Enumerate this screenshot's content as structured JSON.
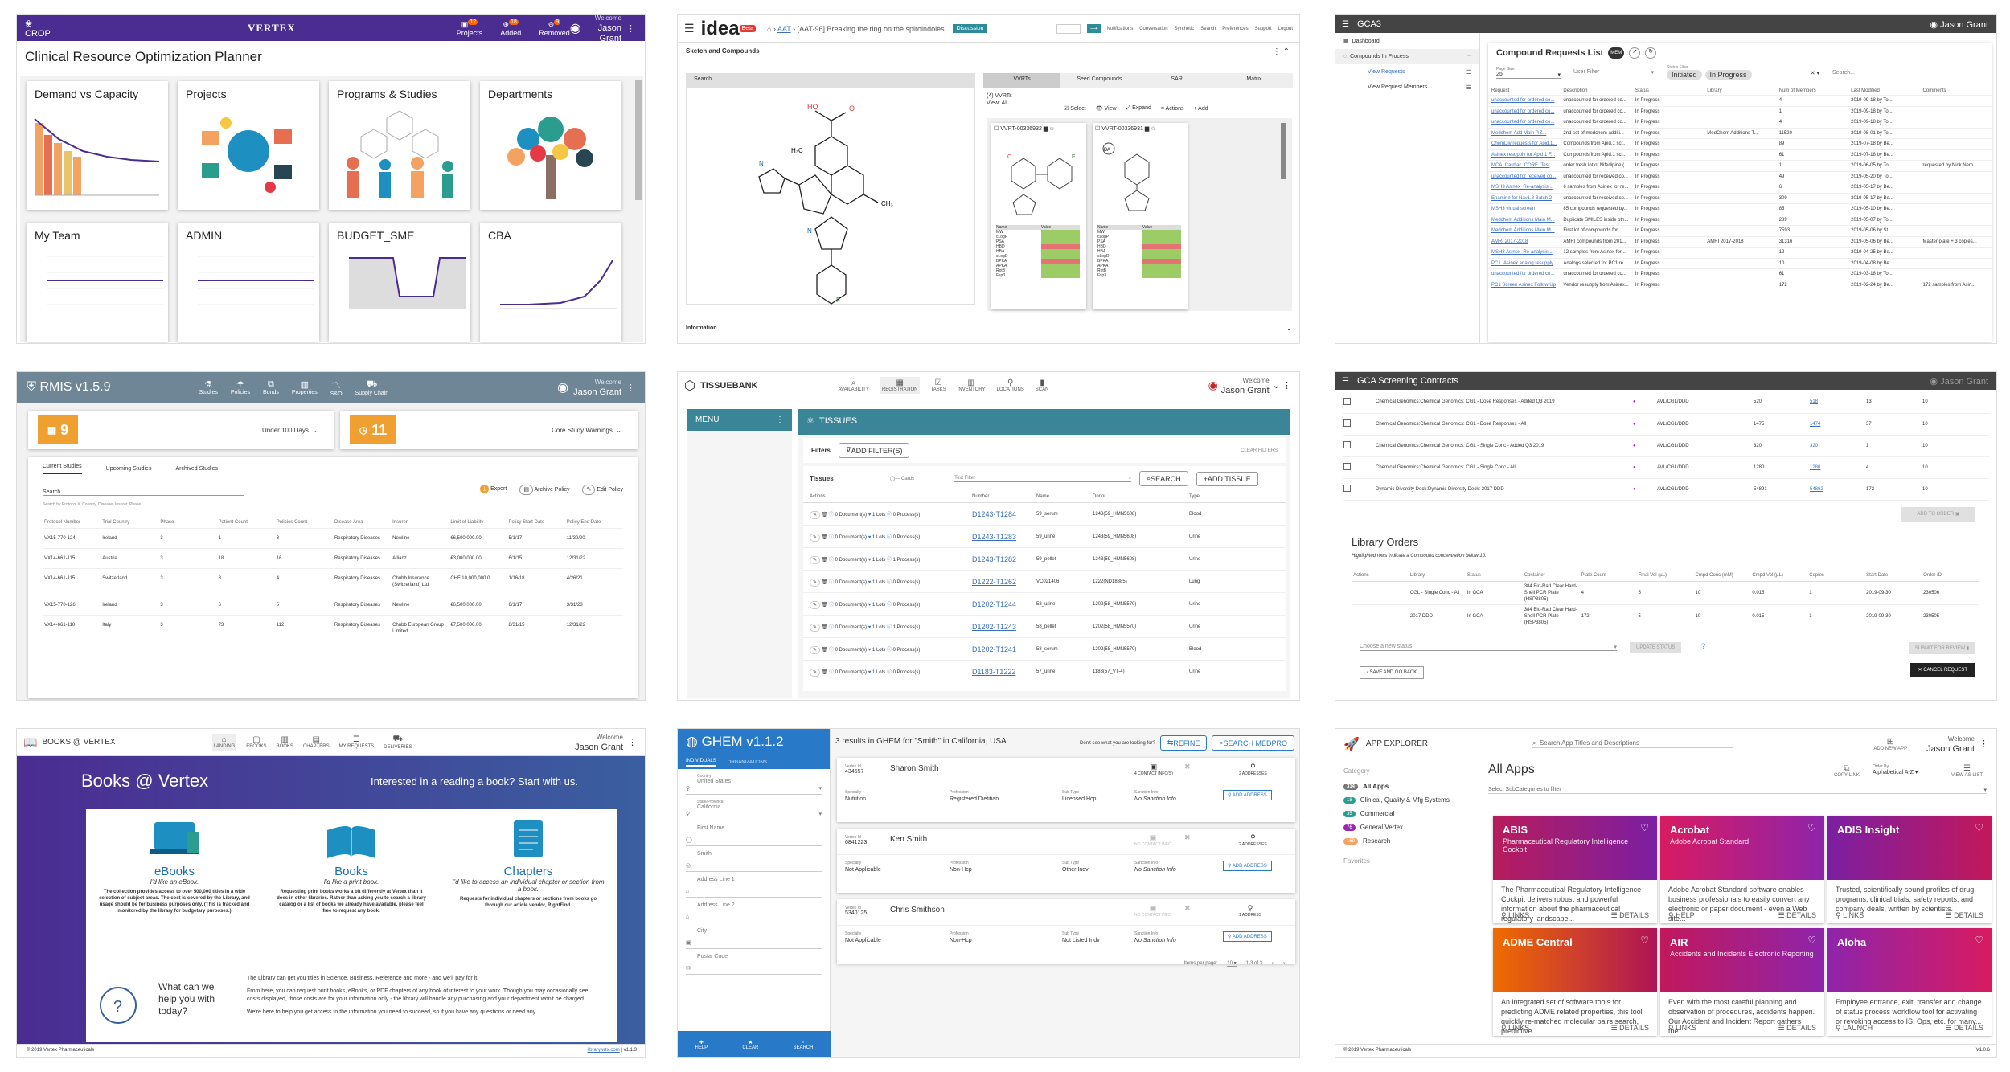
{
  "crop": {
    "brand": "CROP",
    "logo": "VERTEX",
    "welcome": "Welcome",
    "user": "Jason Grant",
    "nav": [
      "Projects",
      "Added",
      "Removed"
    ],
    "badges": [
      "12",
      "18",
      "9"
    ],
    "title": "Clinical Resource Optimization Planner",
    "cards": [
      "Demand vs Capacity",
      "Projects",
      "Programs & Studies",
      "Departments",
      "My Team",
      "ADMIN",
      "BUDGET_SME",
      "CBA"
    ]
  },
  "idea": {
    "logo": "idea",
    "badge": "Beta",
    "crumb": [
      "AAT",
      "[AAT-96] Breaking the ring on the spiroindoles"
    ],
    "status": "Discussion",
    "toolbar": [
      "Notifications",
      "Conversation",
      "Synthetic",
      "Search",
      "Preferences",
      "Support",
      "Logout"
    ],
    "section": "Sketch and Compounds",
    "search_tab": "Search",
    "tabs": [
      "VVRTs",
      "Seed Compounds",
      "SAR",
      "Matrix"
    ],
    "list_label": "(4) VVRTs",
    "list_sub": "View: All",
    "actions": [
      "Select",
      "View",
      "Expand",
      "Actions",
      "Add"
    ],
    "cpd1": "VVRT-00336932",
    "cpd2": "VVRT-00336931",
    "info": "Information",
    "props": [
      "MW",
      "cLogP",
      "PSA",
      "HBD",
      "HBA",
      "cLogD",
      "BPKA",
      "APKA",
      "RotB",
      "Fsp3"
    ],
    "hdr": [
      "Name",
      "Value"
    ]
  },
  "gca3": {
    "title": "GCA3",
    "user": "Jason Grant",
    "nav": [
      "Dashboard",
      "Compounds In Process",
      "View Requests",
      "View Request Members"
    ],
    "list_title": "Compound Requests List",
    "page_size_label": "Page Size",
    "page_size": "25",
    "user_filter": "User Filter",
    "status_label": "Status Filter",
    "chips": [
      "Initiated",
      "In Progress"
    ],
    "search": "Search...",
    "cols": [
      "Request",
      "Description",
      "Status",
      "Library",
      "Num of Members",
      "Last Modified",
      "Comments"
    ],
    "rows": [
      [
        "unaccounted for ordered co...",
        "unaccounted for ordered co...",
        "In Progress",
        "",
        "4",
        "2019-09-18 by To...",
        ""
      ],
      [
        "unaccounted for ordered co...",
        "unaccounted for ordered co...",
        "In Progress",
        "",
        "1",
        "2019-09-18 by To...",
        ""
      ],
      [
        "unaccounted for ordered co...",
        "unaccounted for ordered co...",
        "In Progress",
        "",
        "4",
        "2019-09-18 by To...",
        ""
      ],
      [
        "Medchem Add Main P.Z...",
        "2nd set of medchem additi...",
        "In Progress",
        "MedChem Additions T...",
        "11520",
        "2019-08-01 by To...",
        ""
      ],
      [
        "ChemDiv requests for Apid.1...",
        "Compounds from Apid.1 scr...",
        "In Progress",
        "",
        "89",
        "2019-07-18 by Be...",
        ""
      ],
      [
        "Asinex resupply for Apid.1 F...",
        "Compounds from Apid.1 scr...",
        "In Progress",
        "",
        "61",
        "2019-07-18 by Be...",
        ""
      ],
      [
        "MCA_Cardiac_CORE_Test1 c...",
        "order fresh lot of Nifedipine (...",
        "In Progress",
        "",
        "1",
        "2019-06-05 by To...",
        "requested by Nick Nem..."
      ],
      [
        "unaccounted for received co...",
        "unaccounted for received co...",
        "In Progress",
        "",
        "49",
        "2019-05-20 by To...",
        ""
      ],
      [
        "MSH3 Asinex_Re-analysis...",
        "6 samples from Asinex for re...",
        "In Progress",
        "",
        "6",
        "2019-05-17 by Be...",
        ""
      ],
      [
        "Enamine for Nav1.8 Batch 2",
        "unaccounted for received co...",
        "In Progress",
        "",
        "309",
        "2019-05-17 by Be...",
        ""
      ],
      [
        "MSH3 virtual screen",
        "85 compounds requested by...",
        "In Progress",
        "",
        "85",
        "2019-05-10 by Be...",
        ""
      ],
      [
        "Medchem Additions Main M...",
        "Duplicate SMILES inside oth...",
        "In Progress",
        "",
        "289",
        "2019-05-07 by To...",
        ""
      ],
      [
        "Medchem Additions Main M...",
        "First lot of compounds for ...",
        "In Progress",
        "",
        "7593",
        "2019-05-06 by St...",
        ""
      ],
      [
        "AMRI 2017-2018",
        "AMRI compounds from 201...",
        "In Progress",
        "AMRI 2017-2018",
        "31316",
        "2019-05-06 by Be...",
        "Master plate + 3 copies..."
      ],
      [
        "MSH3 Asinex_Re-analysis...",
        "12 samples from Asinex for ...",
        "In Progress",
        "",
        "12",
        "2019-04-25 by Be...",
        ""
      ],
      [
        "PC1_Asinex analog resupply",
        "Analogs selected for PC1 re...",
        "In Progress",
        "",
        "10",
        "2019-04-08 by Be...",
        ""
      ],
      [
        "unaccounted for ordered co...",
        "unaccounted for ordered co...",
        "In Progress",
        "",
        "61",
        "2019-03-18 by To...",
        ""
      ],
      [
        "PC1 Screen Asinex Follow Up",
        "Vendor resupply from Asinex...",
        "In Progress",
        "",
        "172",
        "2019-02-24 by Be...",
        "172 samples from Asin..."
      ]
    ]
  },
  "rmis": {
    "title": "RMIS v1.5.9",
    "nav": [
      "Studies",
      "Policies",
      "Bonds",
      "Properties",
      "S&O",
      "Supply Chain"
    ],
    "welcome": "Welcome",
    "user": "Jason Grant",
    "k1": "9",
    "k1_label": "Under 100 Days",
    "k2": "11",
    "k2_label": "Core Study Warnings",
    "tabs": [
      "Current Studies",
      "Upcoming Studies",
      "Archived Studies"
    ],
    "search": "Search",
    "search_hint": "Search by Protocol #, Country, Disease, Insurer, Phase",
    "actions": [
      "Export",
      "Archive Policy",
      "Edit Policy"
    ],
    "cols": [
      "Protocol Number",
      "Trial Country",
      "Phase",
      "Patient Count",
      "Policies Count",
      "Disease Area",
      "Insurer",
      "Limit of Liability",
      "Policy Start Date",
      "Policy End Date"
    ],
    "rows": [
      [
        "VX15-770-124",
        "Ireland",
        "3",
        "1",
        "3",
        "Respiratory Diseases",
        "Newline",
        "€6,500,000.00",
        "5/1/17",
        "11/30/20"
      ],
      [
        "VX14-661-115",
        "Austria",
        "3",
        "18",
        "16",
        "Respiratory Diseases",
        "Allianz",
        "€3,000,000.00",
        "6/1/15",
        "12/31/22"
      ],
      [
        "VX14-661-115",
        "Switzerland",
        "3",
        "8",
        "4",
        "Respiratory Diseases",
        "Chubb Insurance (Switzerland) Ltd",
        "CHF 10,000,000.0",
        "1/16/18",
        "4/26/21"
      ],
      [
        "VX15-770-126",
        "Ireland",
        "3",
        "6",
        "5",
        "Respiratory Diseases",
        "Newline",
        "€6,500,000.00",
        "6/1/17",
        "3/31/23"
      ],
      [
        "VX14-661-110",
        "Italy",
        "3",
        "73",
        "112",
        "Respiratory Diseases",
        "Chubb European Group Limited",
        "€7,500,000.00",
        "8/31/15",
        "12/31/22"
      ]
    ]
  },
  "tissue": {
    "title": "TISSUEBANK",
    "nav": [
      "AVAILABILITY",
      "REGISTRATION",
      "TASKS",
      "INVENTORY",
      "LOCATIONS",
      "SCAN"
    ],
    "welcome": "Welcome",
    "user": "Jason Grant",
    "menu": "MENU",
    "section": "TISSUES",
    "filters": "Filters",
    "add_filter": "ADD FILTER(S)",
    "clear": "CLEAR FILTERS",
    "tissues": "Tissues",
    "cards": "Cards",
    "text_filter": "Text Filter",
    "search_btn": "SEARCH",
    "add_btn": "ADD TISSUE",
    "cols": [
      "Actions",
      "Number",
      "Name",
      "Donor",
      "Type"
    ],
    "rows": [
      [
        "0 Document(s)",
        "1 Lots",
        "0 Process(s)",
        "D1243-T1284",
        "59_serum",
        "1243(59_HMN5608)",
        "Blood"
      ],
      [
        "0 Document(s)",
        "1 Lots",
        "0 Process(s)",
        "D1243-T1283",
        "59_urine",
        "1243(59_HMN5608)",
        "Urine"
      ],
      [
        "0 Document(s)",
        "1 Lots",
        "1 Process(s)",
        "D1243-T1282",
        "59_pellet",
        "1243(59_HMN5608)",
        "Urine"
      ],
      [
        "0 Document(s)",
        "1 Lots",
        "0 Process(s)",
        "D1222-T1262",
        "VC021406",
        "1222(ND18385)",
        "Lung"
      ],
      [
        "0 Document(s)",
        "1 Lots",
        "0 Process(s)",
        "D1202-T1244",
        "58_urine",
        "1202(58_HMN5570)",
        "Urine"
      ],
      [
        "0 Document(s)",
        "1 Lots",
        "1 Process(s)",
        "D1202-T1243",
        "58_pellet",
        "1202(58_HMN5570)",
        "Urine"
      ],
      [
        "0 Document(s)",
        "1 Lots",
        "0 Process(s)",
        "D1202-T1241",
        "58_serum",
        "1202(58_HMN5570)",
        "Blood"
      ],
      [
        "0 Document(s)",
        "1 Lots",
        "0 Process(s)",
        "D1183-T1222",
        "57_urine",
        "1183(57_VT-4)",
        "Urine"
      ]
    ]
  },
  "gcas": {
    "title": "GCA Screening Contracts",
    "user": "Jason Grant",
    "rows": [
      [
        "Chemical Genomics:Chemical Genomics: CGL - Dose Responses - Added Q3 2019",
        "AVL/CGL/DDD",
        "520",
        "518",
        "13",
        "10"
      ],
      [
        "Chemical Genomics:Chemical Genomics: CGL - Dose Responses - All",
        "AVL/CGL/DDD",
        "1475",
        "1474",
        "37",
        "10"
      ],
      [
        "Chemical Genomics:Chemical Genomics: CGL - Single Conc - Added Q3 2019",
        "AVL/CGL/DDD",
        "320",
        "320",
        "1",
        "10"
      ],
      [
        "Chemical Genomics:Chemical Genomics: CGL - Single Conc - All",
        "AVL/CGL/DDD",
        "1280",
        "1280",
        "4",
        "10"
      ],
      [
        "Dynamic Diversity Deck:Dynamic Diversity Deck: 2017 DDD",
        "AVL/CGL/DDD",
        "54891",
        "54862",
        "172",
        "10"
      ]
    ],
    "add_order": "ADD TO ORDER",
    "lib_title": "Library Orders",
    "lib_note": "Highlighted rows indicate a Compound concentration below 10.",
    "cols": [
      "Actions",
      "Library",
      "Status",
      "Container",
      "Plate Count",
      "Final Vol (µL)",
      "Cmpd Conc (mM)",
      "Cmpd Vol (µL)",
      "Copies",
      "Start Date",
      "Order ID"
    ],
    "lib_rows": [
      [
        "",
        "CGL - Single Conc - All",
        "In GCA",
        "384 Bio-Rad Clear Hard-Shell PCR Plate (HSP3805)",
        "4",
        "5",
        "10",
        "0.015",
        "1",
        "2019-09-30",
        "230506"
      ],
      [
        "",
        "2017 DDD",
        "In GCA",
        "384 Bio-Rad Clear Hard-Shell PCR Plate (HSP3805)",
        "172",
        "5",
        "10",
        "0.015",
        "1",
        "2019-09-30",
        "230505"
      ]
    ],
    "status_ph": "Choose a new status",
    "update": "UPDATE STATUS",
    "submit": "SUBMIT FOR REVIEW",
    "save": "SAVE AND GO BACK",
    "cancel": "CANCEL REQUEST"
  },
  "books": {
    "title": "BOOKS @ VERTEX",
    "nav": [
      "LANDING",
      "EBOOKS",
      "BOOKS",
      "CHAPTERS",
      "MY REQUESTS",
      "DELIVERIES"
    ],
    "welcome": "Welcome",
    "user": "Jason Grant",
    "hero": "Books @ Vertex",
    "hero_sub": "Interested in a reading a book? Start with us.",
    "items": [
      {
        "t": "eBooks",
        "s": "I'd like an eBook.",
        "d": "The collection provides access to over 500,000 titles in a wide selection of subject areas. The cost is covered by the Library, and usage should be for business purposes only. (This is tracked and monitored by the library for budgetary purposes.)"
      },
      {
        "t": "Books",
        "s": "I'd like a print book.",
        "d": "Requesting print books works a bit differently at Vertex than it does in other libraries. Rather than asking you to search a library catalog or a list of books we already have available, please feel free to request any book."
      },
      {
        "t": "Chapters",
        "s": "I'd like to access an individual chapter or section from a book.",
        "d": "Requests for individual chapters or sections from books go through our article vendor, RightFind."
      }
    ],
    "help": "What can we help you with today?",
    "p1": "The Library can get you titles in Science, Business, Reference and more - and we'll pay for it.",
    "p2": "From here, you can request print books, eBooks, or PDF chapters of any book of interest to your work. Though you may occasionally see costs displayed, those costs are for your information only - the library will handle any purchasing and your department won't be charged.",
    "p3": "We're here to help you get access to the information you need to succeed, so if you have any questions or need any",
    "copy": "© 2019 Vertex Pharmaceuticals",
    "link": "library.vrtx.com",
    "ver": "v1.1.3"
  },
  "ghem": {
    "title": "GHEM v1.1.2",
    "tabs": [
      "INDIVIDUALS",
      "ORGANIZATIONS"
    ],
    "fields": [
      [
        "Country",
        "United States"
      ],
      [
        "State/Province",
        "California"
      ],
      [
        "",
        "First Name"
      ],
      [
        "",
        "Smith"
      ],
      [
        "",
        "Address Line 1"
      ],
      [
        "",
        "Address Line 2"
      ],
      [
        "",
        "City"
      ],
      [
        "",
        "Postal Code"
      ]
    ],
    "bottom": [
      "HELP",
      "CLEAR",
      "SEARCH"
    ],
    "results": "3 results in GHEM for \"Smith\" in California, USA",
    "not_found": "Don't see what you are looking for?",
    "refine": "REFINE",
    "medpro": "SEARCH MEDPRO",
    "people": [
      {
        "id": "434557",
        "name": "Sharon Smith",
        "spec": "Nutrition",
        "prof": "Registered Dietitian",
        "sub": "Licensed Hcp",
        "sanc": "No Sanction Info",
        "contacts": "4 CONTACT INFO(S)",
        "addr": "2 ADDRESSES"
      },
      {
        "id": "6841223",
        "name": "Ken Smith",
        "spec": "Not Applicable",
        "prof": "Non-Hcp",
        "sub": "Other Indv",
        "sanc": "No Sanction Info",
        "contacts": "NO CONTACT INFO",
        "addr": "2 ADDRESSES"
      },
      {
        "id": "5340125",
        "name": "Chris Smithson",
        "spec": "Not Applicable",
        "prof": "Non-Hcp",
        "sub": "Not Listed Indv",
        "sanc": "No Sanction Info",
        "contacts": "NO CONTACT INFO",
        "addr": "1 ADDRESS"
      }
    ],
    "labels": [
      "Vertex Id",
      "Specialty",
      "Profession",
      "Sub Type",
      "Sanction Info"
    ],
    "add_addr": "ADD ADDRESS",
    "per_page": "Items per page:",
    "pp": "10",
    "range": "1-3 of 3"
  },
  "apps": {
    "title": "APP EXPLORER",
    "search": "Search App Titles and Descriptions",
    "add": "ADD NEW APP",
    "welcome": "Welcome",
    "user": "Jason Grant",
    "cat_label": "Category",
    "cats": [
      [
        "314",
        "All Apps"
      ],
      [
        "18",
        "Clinical, Quality & Mfg Systems"
      ],
      [
        "35",
        "Commercial"
      ],
      [
        "76",
        "General Vertex"
      ],
      [
        "169",
        "Research"
      ]
    ],
    "fav": "Favorites",
    "heading": "All Apps",
    "copy_link": "COPY LINK",
    "order_label": "Order By:",
    "order": "Alphabetical A-Z",
    "view": "VIEW AS LIST",
    "subcat": "Select SubCategories to filter",
    "tiles": [
      {
        "t": "ABIS",
        "s": "Pharmaceutical Regulatory Intelligence Cockpit",
        "d": "The Pharmaceutical Regulatory Intelligence Cockpit delivers robust and powerful information about the pharmaceutical regulatory landscape...",
        "a": "LINKS",
        "b": "DETAILS"
      },
      {
        "t": "Acrobat",
        "s": "Adobe Acrobat Standard",
        "d": "Adobe Acrobat Standard software enables business professionals to easily convert any electronic or paper document - even a Web site...",
        "a": "HELP",
        "b": "DETAILS"
      },
      {
        "t": "ADIS Insight",
        "s": "",
        "d": "Trusted, scientifically sound profiles of drug programs, clinical trials, safety reports, and company deals, written by scientists.",
        "a": "LINKS",
        "b": "DETAILS"
      },
      {
        "t": "ADME Central",
        "s": "",
        "d": "An integrated set of software tools for predicting ADME related properties, this tool quickly re-matched molecular pairs search, predictive...",
        "a": "LINKS",
        "b": "DETAILS"
      },
      {
        "t": "AIR",
        "s": "Accidents and Incidents Electronic Reporting",
        "d": "Even with the most careful planning and observation of procedures, accidents happen. Our Accident and Incident Report gathers the...",
        "a": "LINKS",
        "b": "DETAILS"
      },
      {
        "t": "Aloha",
        "s": "",
        "d": "Employee entrance, exit, transfer and change of status process workflow tool for activating or revoking access to IS, Ops, etc. for many...",
        "a": "LAUNCH",
        "b": "DETAILS"
      }
    ],
    "copy": "© 2019 Vertex Pharmaceuticals",
    "ver": "V1.0.6"
  }
}
